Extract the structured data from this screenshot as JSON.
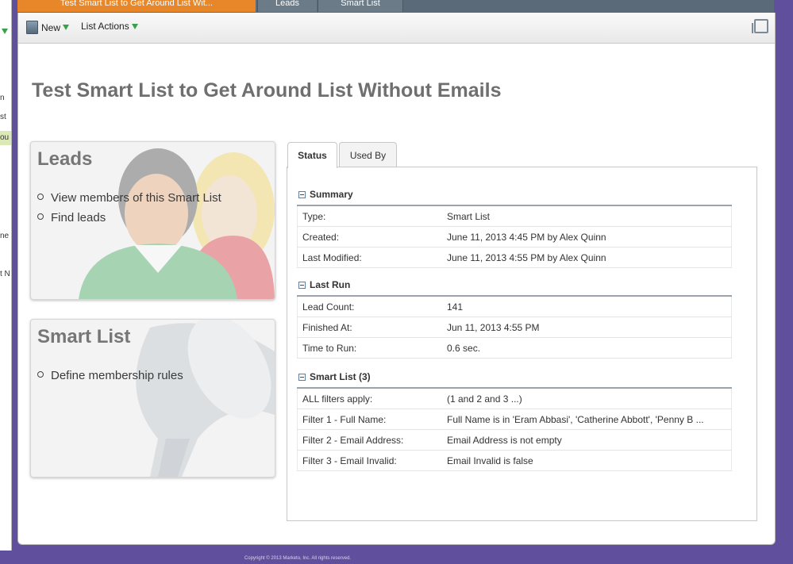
{
  "top_tabs": [
    "Test Smart List to Get Around List Wit...",
    "Leads",
    "Smart List"
  ],
  "left_strip": [
    "n",
    "st",
    "ou",
    "ne",
    "t N"
  ],
  "toolbar": {
    "new_label": "New",
    "list_actions_label": "List Actions"
  },
  "page_title": "Test Smart List to Get Around List Without Emails",
  "leads_card": {
    "title": "Leads",
    "items": [
      "View members of this Smart List",
      "Find leads"
    ]
  },
  "smart_card": {
    "title": "Smart List",
    "items": [
      "Define membership rules"
    ]
  },
  "tabs": {
    "status": "Status",
    "used_by": "Used By"
  },
  "summary": {
    "title": "Summary",
    "rows": [
      {
        "key": "Type:",
        "value": "Smart List"
      },
      {
        "key": "Created:",
        "value": "June 11, 2013 4:45 PM by Alex Quinn"
      },
      {
        "key": "Last Modified:",
        "value": "June 11, 2013 4:55 PM by Alex Quinn"
      }
    ]
  },
  "last_run": {
    "title": "Last Run",
    "rows": [
      {
        "key": "Lead Count:",
        "value": "141"
      },
      {
        "key": "Finished At:",
        "value": "Jun 11, 2013 4:55 PM"
      },
      {
        "key": "Time to Run:",
        "value": "0.6 sec."
      }
    ]
  },
  "smart_list": {
    "title": "Smart List (3)",
    "rows": [
      {
        "key": "ALL filters apply:",
        "value": "(1 and 2 and 3 ...)"
      },
      {
        "key": "Filter 1 - Full Name:",
        "value": "Full Name is in 'Eram Abbasi', 'Catherine Abbott', 'Penny B ..."
      },
      {
        "key": "Filter 2 - Email Address:",
        "value": "Email Address is not empty"
      },
      {
        "key": "Filter 3 - Email Invalid:",
        "value": "Email Invalid is false"
      }
    ]
  },
  "footer": "Copyright © 2013 Marketo, Inc. All rights reserved.",
  "colors": {
    "accent_orange": "#e8862a",
    "tab_bar": "#5a6a78",
    "page_bg": "#5f4f9c"
  }
}
